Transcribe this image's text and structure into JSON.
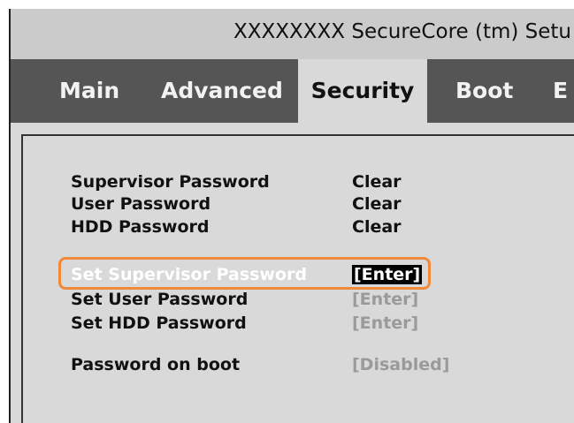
{
  "title": "XXXXXXXX SecureCore (tm) Setu",
  "tabs": [
    {
      "label": "Main"
    },
    {
      "label": "Advanced"
    },
    {
      "label": "Security"
    },
    {
      "label": "Boot"
    },
    {
      "label": "E"
    }
  ],
  "rows": {
    "supervisor_password": {
      "label": "Supervisor Password",
      "value": "Clear"
    },
    "user_password": {
      "label": "User Password",
      "value": "Clear"
    },
    "hdd_password": {
      "label": "HDD Password",
      "value": "Clear"
    },
    "set_supervisor_password": {
      "label": "Set Supervisor Password",
      "value": "[Enter]"
    },
    "set_user_password": {
      "label": "Set User Password",
      "value": "[Enter]"
    },
    "set_hdd_password": {
      "label": "Set HDD Password",
      "value": "[Enter]"
    },
    "password_on_boot": {
      "label": "Password on boot",
      "value": "[Disabled]"
    }
  },
  "colors": {
    "highlight": "#f08a3a",
    "tab_bar": "#555555",
    "active_tab": "#d9d9d9",
    "disabled_text": "#9a9a9a"
  }
}
